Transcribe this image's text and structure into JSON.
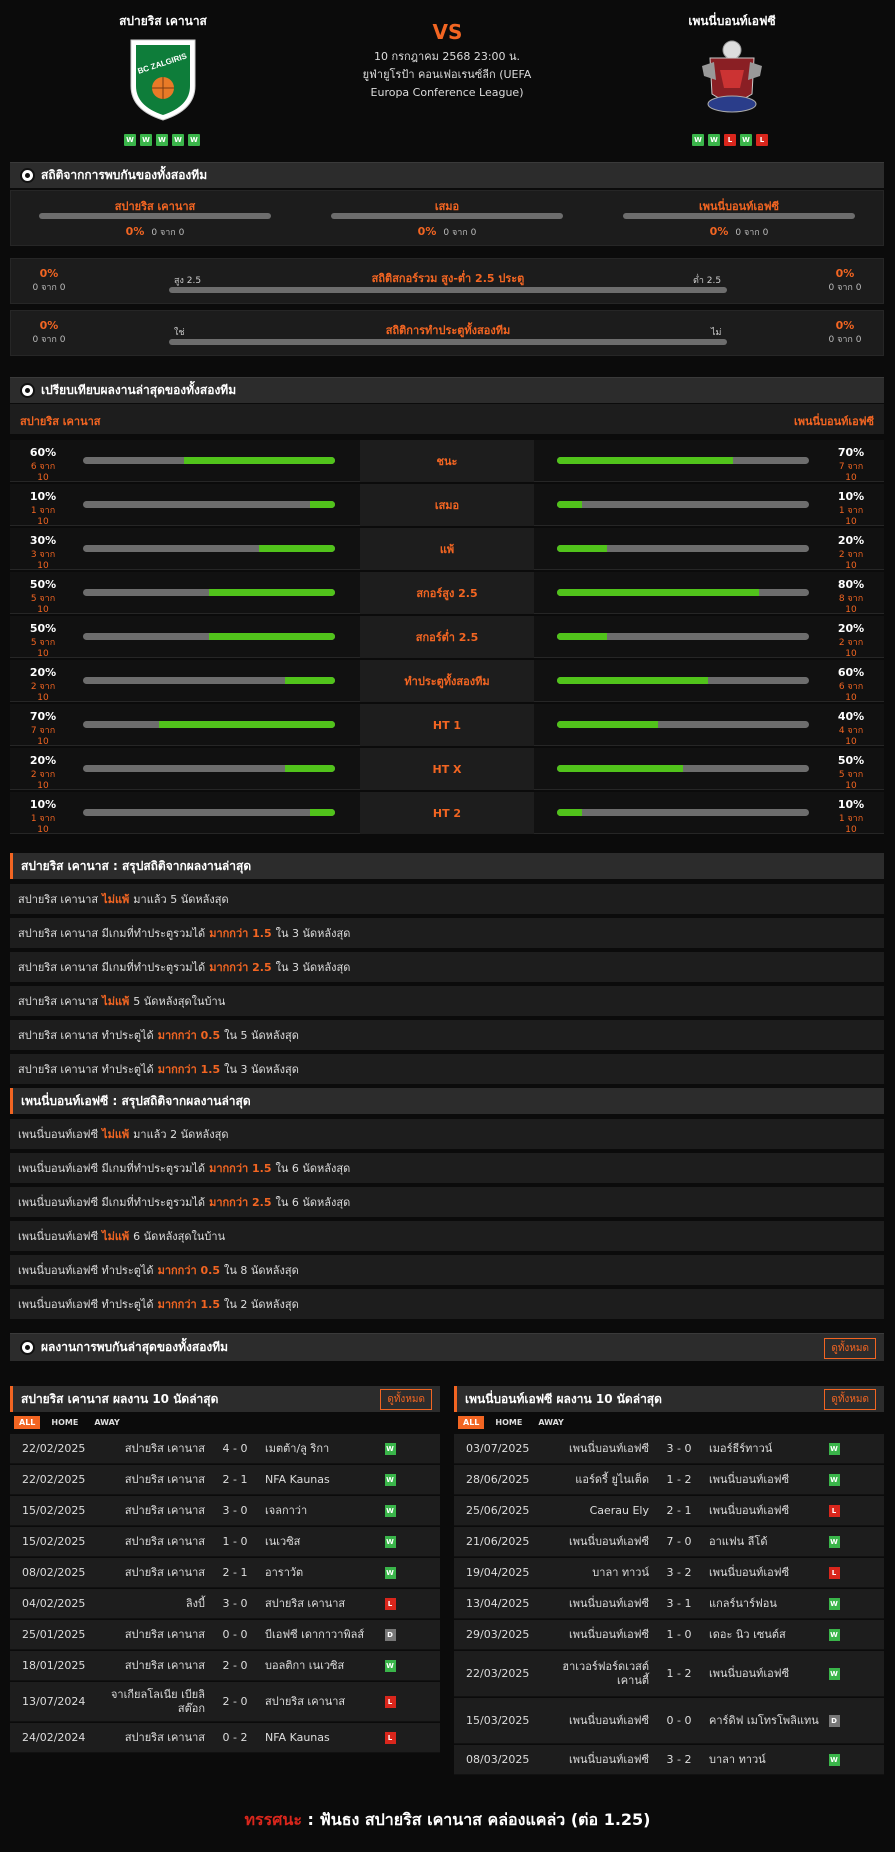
{
  "header": {
    "home_name": "สปายริส เคานาส",
    "away_name": "เพนนี่บอนท์เอฟซี",
    "vs": "VS",
    "date": "10 กรกฎาคม 2568 23:00 น.",
    "league": "ยูฟ่ายูโรป้า คอนเฟอเรนซ์ลีก (UEFA Europa Conference League)",
    "home_form": [
      "W",
      "W",
      "W",
      "W",
      "W"
    ],
    "away_form": [
      "W",
      "W",
      "L",
      "W",
      "L"
    ],
    "home_logo_text": "BC ZALGIRIS"
  },
  "h2h": {
    "title": "สถิติจากการพบกันของทั้งสองทีม",
    "home_label": "สปายริส เคานาส",
    "draw_label": "เสมอ",
    "away_label": "เพนนี่บอนท์เอฟซี",
    "home_pct": "0%",
    "home_sub": "0 จาก 0",
    "draw_pct": "0%",
    "draw_sub": "0 จาก 0",
    "away_pct": "0%",
    "away_sub": "0 จาก 0",
    "ou_title": "สถิติสกอร์รวม สูง-ต่ำ 2.5 ประตู",
    "ou_left": "สูง 2.5",
    "ou_right": "ต่ำ 2.5",
    "ou_lpct": "0%",
    "ou_lsub": "0 จาก 0",
    "ou_rpct": "0%",
    "ou_rsub": "0 จาก 0",
    "btts_title": "สถิติการทำประตูทั้งสองทีม",
    "btts_left": "ใช่",
    "btts_right": "ไม่",
    "btts_lpct": "0%",
    "btts_lsub": "0 จาก 0",
    "btts_rpct": "0%",
    "btts_rsub": "0 จาก 0"
  },
  "compare": {
    "title": "เปรียบเทียบผลงานล่าสุดของทั้งสองทีม",
    "home_label": "สปายริส เคานาส",
    "away_label": "เพนนี่บอนท์เอฟซี",
    "rows": [
      {
        "label": "ชนะ",
        "lpct": "60%",
        "lsub": "6 จาก 10",
        "lval": 60,
        "rpct": "70%",
        "rsub": "7 จาก 10",
        "rval": 70
      },
      {
        "label": "เสมอ",
        "lpct": "10%",
        "lsub": "1 จาก 10",
        "lval": 10,
        "rpct": "10%",
        "rsub": "1 จาก 10",
        "rval": 10
      },
      {
        "label": "แพ้",
        "lpct": "30%",
        "lsub": "3 จาก 10",
        "lval": 30,
        "rpct": "20%",
        "rsub": "2 จาก 10",
        "rval": 20
      },
      {
        "label": "สกอร์สูง 2.5",
        "lpct": "50%",
        "lsub": "5 จาก 10",
        "lval": 50,
        "rpct": "80%",
        "rsub": "8 จาก 10",
        "rval": 80
      },
      {
        "label": "สกอร์ต่ำ 2.5",
        "lpct": "50%",
        "lsub": "5 จาก 10",
        "lval": 50,
        "rpct": "20%",
        "rsub": "2 จาก 10",
        "rval": 20
      },
      {
        "label": "ทำประตูทั้งสองทีม",
        "lpct": "20%",
        "lsub": "2 จาก 10",
        "lval": 20,
        "rpct": "60%",
        "rsub": "6 จาก 10",
        "rval": 60
      },
      {
        "label": "HT 1",
        "lpct": "70%",
        "lsub": "7 จาก 10",
        "lval": 70,
        "rpct": "40%",
        "rsub": "4 จาก 10",
        "rval": 40
      },
      {
        "label": "HT X",
        "lpct": "20%",
        "lsub": "2 จาก 10",
        "lval": 20,
        "rpct": "50%",
        "rsub": "5 จาก 10",
        "rval": 50
      },
      {
        "label": "HT 2",
        "lpct": "10%",
        "lsub": "1 จาก 10",
        "lval": 10,
        "rpct": "10%",
        "rsub": "1 จาก 10",
        "rval": 10
      }
    ]
  },
  "home_summary": {
    "title": "สปายริส เคานาส : สรุปสถิติจากผลงานล่าสุด",
    "rows": [
      {
        "pre": "สปายริส เคานาส",
        "hl": "ไม่แพ้",
        "post": "มาแล้ว 5 นัดหลังสุด"
      },
      {
        "pre": "สปายริส เคานาส  มีเกมที่ทำประตูรวมได้",
        "hl": "มากกว่า 1.5",
        "post": "ใน 3 นัดหลังสุด"
      },
      {
        "pre": "สปายริส เคานาส  มีเกมที่ทำประตูรวมได้",
        "hl": "มากกว่า 2.5",
        "post": "ใน 3 นัดหลังสุด"
      },
      {
        "pre": "สปายริส เคานาส",
        "hl": "ไม่แพ้",
        "post": "5  นัดหลังสุดในบ้าน"
      },
      {
        "pre": "สปายริส เคานาส  ทำประตูได้",
        "hl": "มากกว่า 0.5",
        "post": "ใน 5 นัดหลังสุด"
      },
      {
        "pre": "สปายริส เคานาส  ทำประตูได้",
        "hl": "มากกว่า 1.5",
        "post": "ใน 3 นัดหลังสุด"
      }
    ]
  },
  "away_summary": {
    "title": "เพนนี่บอนท์เอฟซี : สรุปสถิติจากผลงานล่าสุด",
    "rows": [
      {
        "pre": "เพนนี่บอนท์เอฟซี",
        "hl": "ไม่แพ้",
        "post": "มาแล้ว 2 นัดหลังสุด"
      },
      {
        "pre": "เพนนี่บอนท์เอฟซี  มีเกมที่ทำประตูรวมได้",
        "hl": "มากกว่า 1.5",
        "post": "ใน 6 นัดหลังสุด"
      },
      {
        "pre": "เพนนี่บอนท์เอฟซี  มีเกมที่ทำประตูรวมได้",
        "hl": "มากกว่า 2.5",
        "post": "ใน 6 นัดหลังสุด"
      },
      {
        "pre": "เพนนี่บอนท์เอฟซี",
        "hl": "ไม่แพ้",
        "post": "6  นัดหลังสุดในบ้าน"
      },
      {
        "pre": "เพนนี่บอนท์เอฟซี  ทำประตูได้",
        "hl": "มากกว่า 0.5",
        "post": "ใน 8 นัดหลังสุด"
      },
      {
        "pre": "เพนนี่บอนท์เอฟซี  ทำประตูได้",
        "hl": "มากกว่า 1.5",
        "post": "ใน 2 นัดหลังสุด"
      }
    ]
  },
  "recent_h2h": {
    "title": "ผลงานการพบกันล่าสุดของทั้งสองทีม",
    "view_all": "ดูทั้งหมด"
  },
  "home_recent": {
    "title": "สปายริส เคานาส ผลงาน 10 นัดล่าสุด",
    "view_all": "ดูทั้งหมด",
    "tabs": [
      "ALL",
      "HOME",
      "AWAY"
    ],
    "matches": [
      {
        "date": "22/02/2025",
        "home": "สปายริส เคานาส",
        "score": "4 - 0",
        "away": "เมตต้า/ลู ริกา",
        "res": "W"
      },
      {
        "date": "22/02/2025",
        "home": "สปายริส เคานาส",
        "score": "2 - 1",
        "away": "NFA Kaunas",
        "res": "W"
      },
      {
        "date": "15/02/2025",
        "home": "สปายริส เคานาส",
        "score": "3 - 0",
        "away": "เจลกาว่า",
        "res": "W"
      },
      {
        "date": "15/02/2025",
        "home": "สปายริส เคานาส",
        "score": "1 - 0",
        "away": "เนเวซิส",
        "res": "W"
      },
      {
        "date": "08/02/2025",
        "home": "สปายริส เคานาส",
        "score": "2 - 1",
        "away": "อาราวัต",
        "res": "W"
      },
      {
        "date": "04/02/2025",
        "home": "ลิงบี้",
        "score": "3 - 0",
        "away": "สปายริส เคานาส",
        "res": "L"
      },
      {
        "date": "25/01/2025",
        "home": "สปายริส เคานาส",
        "score": "0 - 0",
        "away": "บีเอฟซี เดากาวาพิลส์",
        "res": "D"
      },
      {
        "date": "18/01/2025",
        "home": "สปายริส เคานาส",
        "score": "2 - 0",
        "away": "บอลติกา เนเวซิส",
        "res": "W"
      },
      {
        "date": "13/07/2024",
        "home": "จาเกียลโลเนีย เบียลิสต๊อก",
        "score": "2 - 0",
        "away": "สปายริส เคานาส",
        "res": "L"
      },
      {
        "date": "24/02/2024",
        "home": "สปายริส เคานาส",
        "score": "0 - 2",
        "away": "NFA Kaunas",
        "res": "L"
      }
    ]
  },
  "away_recent": {
    "title": "เพนนี่บอนท์เอฟซี ผลงาน 10 นัดล่าสุด",
    "view_all": "ดูทั้งหมด",
    "tabs": [
      "ALL",
      "HOME",
      "AWAY"
    ],
    "matches": [
      {
        "date": "03/07/2025",
        "home": "เพนนี่บอนท์เอฟซี",
        "score": "3 - 0",
        "away": "เมอร์ธีร์ทาวน์",
        "res": "W"
      },
      {
        "date": "28/06/2025",
        "home": "แอร์ดรี้ ยูไนเต็ด",
        "score": "1 - 2",
        "away": "เพนนี่บอนท์เอฟซี",
        "res": "W"
      },
      {
        "date": "25/06/2025",
        "home": "Caerau Ely",
        "score": "2 - 1",
        "away": "เพนนี่บอนท์เอฟซี",
        "res": "L"
      },
      {
        "date": "21/06/2025",
        "home": "เพนนี่บอนท์เอฟซี",
        "score": "7 - 0",
        "away": "อาแฟน ลีโด้",
        "res": "W"
      },
      {
        "date": "19/04/2025",
        "home": "บาลา ทาวน์",
        "score": "3 - 2",
        "away": "เพนนี่บอนท์เอฟซี",
        "res": "L"
      },
      {
        "date": "13/04/2025",
        "home": "เพนนี่บอนท์เอฟซี",
        "score": "3 - 1",
        "away": "แกลร์นาร์ฟอน",
        "res": "W"
      },
      {
        "date": "29/03/2025",
        "home": "เพนนี่บอนท์เอฟซี",
        "score": "1 - 0",
        "away": "เดอะ นิว เซนต์ส",
        "res": "W"
      },
      {
        "date": "22/03/2025",
        "home": "ฮาเวอร์ฟอร์ดเวสต์ เคานตี้",
        "score": "1 - 2",
        "away": "เพนนี่บอนท์เอฟซี",
        "res": "W"
      },
      {
        "date": "15/03/2025",
        "home": "เพนนี่บอนท์เอฟซี",
        "score": "0 - 0",
        "away": "คาร์ดิฟ เมโทรโพลิแทน",
        "res": "D"
      },
      {
        "date": "08/03/2025",
        "home": "เพนนี่บอนท์เอฟซี",
        "score": "3 - 2",
        "away": "บาลา ทาวน์",
        "res": "W"
      }
    ]
  },
  "tip": {
    "label": "ทรรศนะ",
    "sep": " :  ",
    "text": "ฟันธง สปายริส เคานาส คล่องแคล่ว (ต่อ 1.25)"
  },
  "colors": {
    "accent": "#f26522",
    "win": "#3ab54a",
    "loss": "#d9261c",
    "draw": "#777777",
    "bar_fill": "#51c31b"
  }
}
